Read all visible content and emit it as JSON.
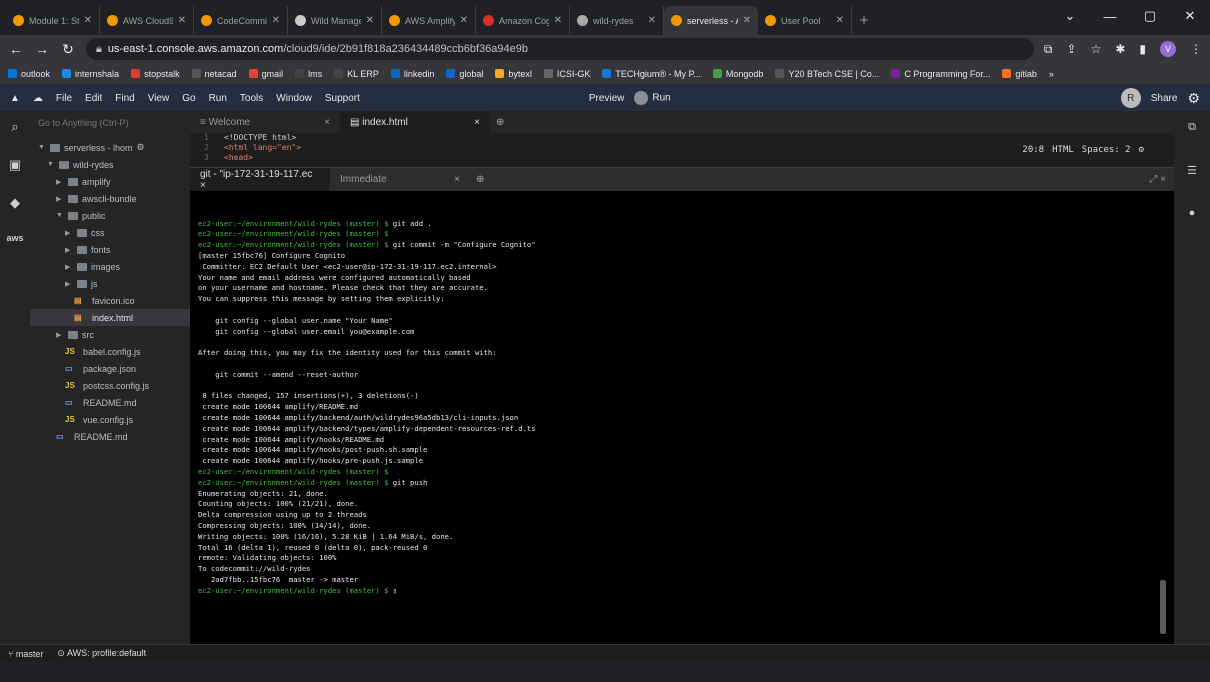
{
  "browser": {
    "tabs": [
      {
        "label": "Module 1: Sta",
        "color": "#f29900"
      },
      {
        "label": "AWS Cloud9",
        "color": "#f29900"
      },
      {
        "label": "CodeCommit",
        "color": "#f29900"
      },
      {
        "label": "Wild Manage",
        "color": "#ccc"
      },
      {
        "label": "AWS Amplify",
        "color": "#f29900"
      },
      {
        "label": "Amazon Cog",
        "color": "#d93025"
      },
      {
        "label": "wild-rydes",
        "color": "#aaa"
      },
      {
        "label": "serverless - Al",
        "color": "#f29900",
        "active": true
      },
      {
        "label": "User Pool",
        "color": "#f29900"
      }
    ],
    "url_host": "us-east-1.console.aws.amazon.com",
    "url_path": "/cloud9/ide/2b91f818a236434489ccb6bf36a94e9b",
    "profile_letter": "V",
    "bookmarks": [
      {
        "label": "outlook",
        "color": "#0078d4"
      },
      {
        "label": "internshala",
        "color": "#1e88e5"
      },
      {
        "label": "stopstalk",
        "color": "#e53935"
      },
      {
        "label": "netacad",
        "color": "#555"
      },
      {
        "label": "gmail",
        "color": "#ea4335"
      },
      {
        "label": "lms",
        "color": "#444"
      },
      {
        "label": "KL ERP",
        "color": "#444"
      },
      {
        "label": "linkedin",
        "color": "#0a66c2"
      },
      {
        "label": "global",
        "color": "#1565c0"
      },
      {
        "label": "bytexl",
        "color": "#f9a825"
      },
      {
        "label": "ICSI-GK",
        "color": "#666"
      },
      {
        "label": "TECHgium® - My P...",
        "color": "#1976d2"
      },
      {
        "label": "Mongodb",
        "color": "#43a047"
      },
      {
        "label": "Y20 BTech CSE | Co...",
        "color": "#555"
      },
      {
        "label": "C Programming For...",
        "color": "#7b1fa2"
      },
      {
        "label": "gitlab",
        "color": "#fc6d26"
      }
    ]
  },
  "ide": {
    "menu": [
      "File",
      "Edit",
      "Find",
      "View",
      "Go",
      "Run",
      "Tools",
      "Window",
      "Support"
    ],
    "preview_label": "Preview",
    "run_label": "Run",
    "share_label": "Share",
    "user_letter": "R",
    "search_placeholder": "Go to Anything (Ctrl-P)",
    "tree": [
      {
        "label": "serverless - lhom",
        "indent": 0,
        "type": "folder",
        "open": true
      },
      {
        "label": "wild-rydes",
        "indent": 1,
        "type": "folder",
        "open": true
      },
      {
        "label": "amplify",
        "indent": 2,
        "type": "folder",
        "open": false
      },
      {
        "label": "awscli-bundle",
        "indent": 2,
        "type": "folder",
        "open": false
      },
      {
        "label": "public",
        "indent": 2,
        "type": "folder",
        "open": true
      },
      {
        "label": "css",
        "indent": 3,
        "type": "folder",
        "open": false
      },
      {
        "label": "fonts",
        "indent": 3,
        "type": "folder",
        "open": false
      },
      {
        "label": "images",
        "indent": 3,
        "type": "folder",
        "open": false
      },
      {
        "label": "js",
        "indent": 3,
        "type": "folder",
        "open": false
      },
      {
        "label": "favicon.ico",
        "indent": 4,
        "type": "file",
        "icon": "▤"
      },
      {
        "label": "index.html",
        "indent": 4,
        "type": "file",
        "icon": "▤",
        "selected": true
      },
      {
        "label": "src",
        "indent": 2,
        "type": "folder",
        "open": false
      },
      {
        "label": "babel.config.js",
        "indent": 3,
        "type": "file",
        "icon": "JS"
      },
      {
        "label": "package.json",
        "indent": 3,
        "type": "file",
        "icon": "▭"
      },
      {
        "label": "postcss.config.js",
        "indent": 3,
        "type": "file",
        "icon": "JS"
      },
      {
        "label": "README.md",
        "indent": 3,
        "type": "file",
        "icon": "▭"
      },
      {
        "label": "vue.config.js",
        "indent": 3,
        "type": "file",
        "icon": "JS"
      },
      {
        "label": "README.md",
        "indent": 2,
        "type": "file",
        "icon": "▭"
      }
    ],
    "editor_tabs": [
      {
        "label": "Welcome",
        "active": false
      },
      {
        "label": "index.html",
        "active": true
      }
    ],
    "code_lines": [
      {
        "n": "1",
        "text": "<!DOCTYPE html>"
      },
      {
        "n": "2",
        "text": "<html lang=\"en\">"
      },
      {
        "n": "3",
        "text": "<head>"
      }
    ],
    "editor_status": {
      "pos": "20:8",
      "lang": "HTML",
      "spaces": "Spaces: 2"
    },
    "terminal_tabs": [
      {
        "label": "git - \"ip-172-31-19-117.ec ×",
        "active": true
      },
      {
        "label": "Immediate",
        "active": false
      }
    ],
    "terminal_lines": [
      {
        "prompt": "ec2-user:~/environment/wild-rydes (master) $",
        "cmd": " git add ."
      },
      {
        "prompt": "ec2-user:~/environment/wild-rydes (master) $",
        "cmd": ""
      },
      {
        "prompt": "ec2-user:~/environment/wild-rydes (master) $",
        "cmd": " git commit -m \"Configure Cognito\""
      },
      {
        "prompt": "",
        "cmd": "[master 15fbc76] Configure Cognito"
      },
      {
        "prompt": "",
        "cmd": " Committer: EC2 Default User <ec2-user@ip-172-31-19-117.ec2.internal>"
      },
      {
        "prompt": "",
        "cmd": "Your name and email address were configured automatically based"
      },
      {
        "prompt": "",
        "cmd": "on your username and hostname. Please check that they are accurate."
      },
      {
        "prompt": "",
        "cmd": "You can suppress this message by setting them explicitly:"
      },
      {
        "prompt": "",
        "cmd": ""
      },
      {
        "prompt": "",
        "cmd": "    git config --global user.name \"Your Name\""
      },
      {
        "prompt": "",
        "cmd": "    git config --global user.email you@example.com"
      },
      {
        "prompt": "",
        "cmd": ""
      },
      {
        "prompt": "",
        "cmd": "After doing this, you may fix the identity used for this commit with:"
      },
      {
        "prompt": "",
        "cmd": ""
      },
      {
        "prompt": "",
        "cmd": "    git commit --amend --reset-author"
      },
      {
        "prompt": "",
        "cmd": ""
      },
      {
        "prompt": "",
        "cmd": " 8 files changed, 157 insertions(+), 3 deletions(-)"
      },
      {
        "prompt": "",
        "cmd": " create mode 100644 amplify/README.md"
      },
      {
        "prompt": "",
        "cmd": " create mode 100644 amplify/backend/auth/wildrydes96a5db13/cli-inputs.json"
      },
      {
        "prompt": "",
        "cmd": " create mode 100644 amplify/backend/types/amplify-dependent-resources-ref.d.ts"
      },
      {
        "prompt": "",
        "cmd": " create mode 100644 amplify/hooks/README.md"
      },
      {
        "prompt": "",
        "cmd": " create mode 100644 amplify/hooks/post-push.sh.sample"
      },
      {
        "prompt": "",
        "cmd": " create mode 100644 amplify/hooks/pre-push.js.sample"
      },
      {
        "prompt": "ec2-user:~/environment/wild-rydes (master) $",
        "cmd": ""
      },
      {
        "prompt": "ec2-user:~/environment/wild-rydes (master) $",
        "cmd": " git push"
      },
      {
        "prompt": "",
        "cmd": "Enumerating objects: 21, done."
      },
      {
        "prompt": "",
        "cmd": "Counting objects: 100% (21/21), done."
      },
      {
        "prompt": "",
        "cmd": "Delta compression using up to 2 threads"
      },
      {
        "prompt": "",
        "cmd": "Compressing objects: 100% (14/14), done."
      },
      {
        "prompt": "",
        "cmd": "Writing objects: 100% (16/16), 5.28 KiB | 1.64 MiB/s, done."
      },
      {
        "prompt": "",
        "cmd": "Total 16 (delta 1), reused 0 (delta 0), pack-reused 0"
      },
      {
        "prompt": "",
        "cmd": "remote: Validating objects: 100%"
      },
      {
        "prompt": "",
        "cmd": "To codecommit://wild-rydes"
      },
      {
        "prompt": "",
        "cmd": "   2ad7fbb..15fbc76  master -> master"
      },
      {
        "prompt": "ec2-user:~/environment/wild-rydes (master) $",
        "cmd": " ▯"
      }
    ],
    "status": {
      "branch": "master",
      "profile": "AWS: profile:default"
    }
  }
}
